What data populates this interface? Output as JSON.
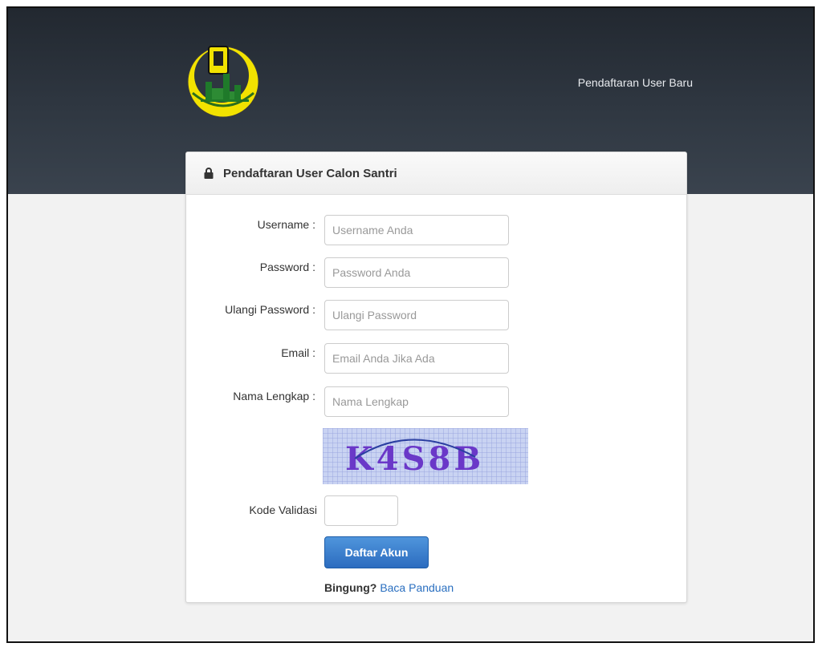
{
  "header": {
    "nav_link": "Pendaftaran User Baru"
  },
  "panel": {
    "title": "Pendaftaran User Calon Santri"
  },
  "form": {
    "fields": [
      {
        "label": "Username :",
        "placeholder": "Username Anda",
        "value": ""
      },
      {
        "label": "Password :",
        "placeholder": "Password Anda",
        "value": ""
      },
      {
        "label": "Ulangi Password :",
        "placeholder": "Ulangi Password",
        "value": ""
      },
      {
        "label": "Email :",
        "placeholder": "Email Anda Jika Ada",
        "value": ""
      },
      {
        "label": "Nama Lengkap :",
        "placeholder": "Nama Lengkap",
        "value": ""
      }
    ],
    "captcha_text": "K4S8B",
    "kode_label": "Kode Validasi",
    "kode_value": "",
    "submit_label": "Daftar Akun",
    "help_prefix": "Bingung?",
    "help_link": "Baca Panduan"
  },
  "colors": {
    "header_bg": "#2e3640",
    "primary_button": "#2c6cbf",
    "link": "#2a6fc0"
  },
  "icons": {
    "lock": "lock-icon",
    "logo": "mosque-emblem"
  }
}
